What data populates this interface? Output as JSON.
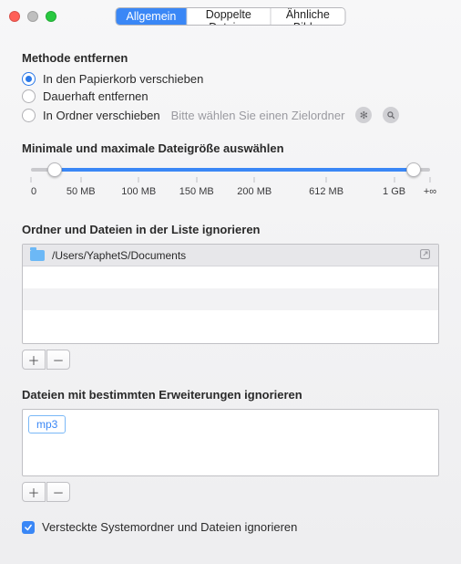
{
  "tabs": {
    "general": "Allgemein",
    "duplicates": "Doppelte Dateien",
    "similar": "Ähnliche Bilder"
  },
  "remove_method": {
    "title": "Methode entfernen",
    "options": {
      "trash": "In den Papierkorb verschieben",
      "permanent": "Dauerhaft entfernen",
      "folder": "In Ordner verschieben"
    },
    "folder_hint": "Bitte wählen Sie einen Zielordner"
  },
  "size_slider": {
    "title": "Minimale und maximale Dateigröße auswählen",
    "positions": [
      0,
      12.5,
      27,
      41.5,
      56,
      74,
      91,
      100
    ],
    "labels": [
      "0",
      "50 MB",
      "100 MB",
      "150 MB",
      "200 MB",
      "612 MB",
      "1 GB",
      "+∞"
    ],
    "low": 6,
    "high": 96
  },
  "ignore_list": {
    "title": "Ordner und Dateien in der Liste ignorieren",
    "items": [
      {
        "path": "/Users/YaphetS/Documents"
      }
    ]
  },
  "ignore_ext": {
    "title": "Dateien mit bestimmten Erweiterungen ignorieren",
    "tags": [
      "mp3"
    ]
  },
  "hidden_checkbox": {
    "label": "Versteckte Systemordner und Dateien ignorieren",
    "checked": true
  }
}
